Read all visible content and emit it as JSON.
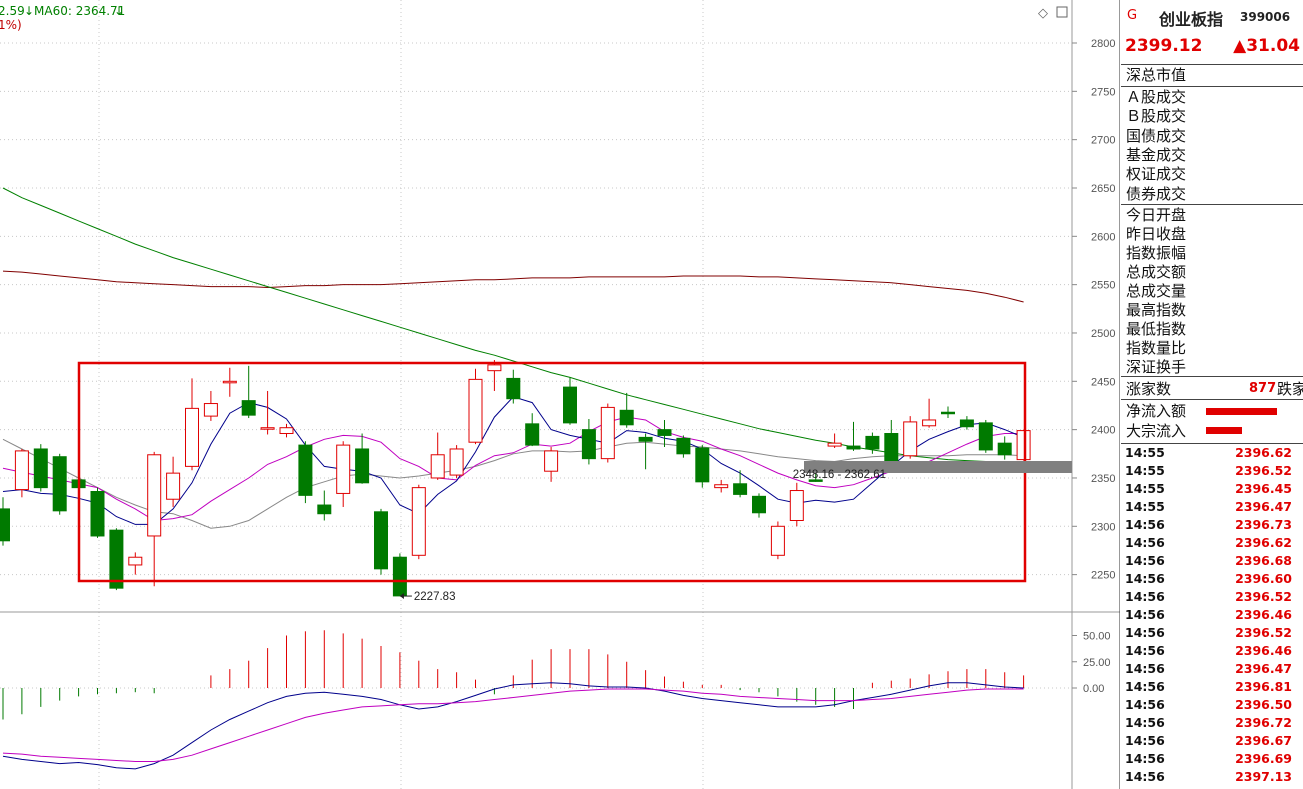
{
  "header": {
    "ma_fragment": "2.59",
    "ma60_label": "MA60: 2364.71",
    "pct_fragment": "1%)"
  },
  "y_axis": {
    "price_ticks": [
      "2800",
      "2750",
      "2700",
      "2650",
      "2600",
      "2550",
      "2500",
      "2450",
      "2400",
      "2350",
      "2300",
      "2250"
    ],
    "volume_ticks": [
      "50.00",
      "25.00",
      "0.00"
    ]
  },
  "annotations": {
    "low_label": "2227.83",
    "range_label": "2348.16 - 2362.61"
  },
  "colors": {
    "up": "#e00000",
    "down": "#007a00",
    "ma5": "#00008b",
    "ma10": "#c000c0",
    "ma20": "#888888",
    "ma60": "#008000",
    "ma250": "#800000",
    "box": "#e00000"
  },
  "chart_data": {
    "type": "candlestick",
    "y_range": [
      2210,
      2820
    ],
    "candles": [
      [
        2318,
        2285,
        2330,
        2280
      ],
      [
        2338,
        2378,
        2380,
        2330
      ],
      [
        2380,
        2340,
        2385,
        2336
      ],
      [
        2372,
        2316,
        2375,
        2312
      ],
      [
        2348,
        2340,
        2360,
        2336
      ],
      [
        2336,
        2290,
        2340,
        2288
      ],
      [
        2296,
        2236,
        2298,
        2234
      ],
      [
        2260,
        2268,
        2273,
        2250
      ],
      [
        2290,
        2374,
        2377,
        2238
      ],
      [
        2328,
        2355,
        2372,
        2320
      ],
      [
        2362,
        2422,
        2453,
        2358
      ],
      [
        2414,
        2427,
        2440,
        2409
      ],
      [
        2450,
        2450,
        2464,
        2434
      ],
      [
        2430,
        2415,
        2466,
        2412
      ],
      [
        2402,
        2402,
        2440,
        2395
      ],
      [
        2396,
        2402,
        2406,
        2392
      ],
      [
        2384,
        2332,
        2388,
        2324
      ],
      [
        2322,
        2313,
        2337,
        2306
      ],
      [
        2334,
        2384,
        2388,
        2320
      ],
      [
        2380,
        2345,
        2396,
        2344
      ],
      [
        2315,
        2256,
        2318,
        2250
      ],
      [
        2268,
        2228,
        2272,
        2227.83
      ],
      [
        2270,
        2340,
        2343,
        2266
      ],
      [
        2350,
        2374,
        2397,
        2348
      ],
      [
        2353,
        2380,
        2384,
        2350
      ],
      [
        2387,
        2452,
        2463,
        2385
      ],
      [
        2461,
        2467,
        2472,
        2440
      ],
      [
        2453,
        2432,
        2462,
        2427
      ],
      [
        2406,
        2384,
        2417,
        2383
      ],
      [
        2357,
        2378,
        2382,
        2346
      ],
      [
        2444,
        2407,
        2454,
        2405
      ],
      [
        2400,
        2370,
        2411,
        2364
      ],
      [
        2370,
        2423,
        2427,
        2366
      ],
      [
        2420,
        2405,
        2438,
        2402
      ],
      [
        2392,
        2388,
        2396,
        2359
      ],
      [
        2400,
        2394,
        2410,
        2382
      ],
      [
        2391,
        2375,
        2394,
        2371
      ],
      [
        2381,
        2346,
        2384,
        2340
      ],
      [
        2340,
        2343,
        2348,
        2335
      ],
      [
        2344,
        2333,
        2358,
        2330
      ],
      [
        2331,
        2314,
        2334,
        2309
      ],
      [
        2270,
        2300,
        2305,
        2266
      ],
      [
        2306,
        2337,
        2345,
        2300
      ],
      [
        2348,
        2347,
        2362.61,
        2346
      ],
      [
        2383,
        2386,
        2396,
        2381
      ],
      [
        2383,
        2380,
        2408,
        2378
      ],
      [
        2393,
        2380,
        2397,
        2375
      ],
      [
        2396,
        2366,
        2410,
        2366
      ],
      [
        2373,
        2408,
        2414,
        2370
      ],
      [
        2404,
        2410,
        2432,
        2402
      ],
      [
        2418,
        2417,
        2424,
        2412
      ],
      [
        2410,
        2403,
        2414,
        2400
      ],
      [
        2407,
        2379,
        2410,
        2376
      ],
      [
        2386,
        2374,
        2393,
        2369
      ],
      [
        2369,
        2399,
        2400,
        2368
      ]
    ],
    "moving_averages": {
      "ma5": [
        2336,
        2338,
        2334,
        2333,
        2329,
        2324,
        2310,
        2302,
        2302,
        2318,
        2345,
        2385,
        2417,
        2428,
        2423,
        2411,
        2384,
        2362,
        2359,
        2357,
        2350,
        2322,
        2313,
        2333,
        2347,
        2377,
        2413,
        2434,
        2428,
        2400,
        2394,
        2390,
        2386,
        2399,
        2397,
        2391,
        2388,
        2380,
        2365,
        2355,
        2342,
        2328,
        2324,
        2327,
        2325,
        2328,
        2345,
        2362,
        2378,
        2390,
        2398,
        2405,
        2407,
        2400,
        2392
      ],
      "ma10": [
        2360,
        2356,
        2352,
        2348,
        2344,
        2340,
        2328,
        2318,
        2306,
        2308,
        2312,
        2326,
        2338,
        2350,
        2364,
        2372,
        2382,
        2390,
        2394,
        2393,
        2387,
        2370,
        2362,
        2350,
        2348,
        2363,
        2373,
        2376,
        2385,
        2383,
        2386,
        2398,
        2408,
        2413,
        2410,
        2398,
        2392,
        2388,
        2380,
        2373,
        2364,
        2355,
        2348,
        2342,
        2340,
        2343,
        2350,
        2357,
        2362,
        2367,
        2376,
        2385,
        2393,
        2396,
        2396
      ],
      "ma20": [
        2390,
        2380,
        2370,
        2360,
        2350,
        2340,
        2330,
        2322,
        2315,
        2313,
        2306,
        2298,
        2300,
        2306,
        2318,
        2330,
        2340,
        2346,
        2352,
        2354,
        2352,
        2350,
        2352,
        2355,
        2358,
        2362,
        2368,
        2375,
        2378,
        2378,
        2377,
        2378,
        2382,
        2386,
        2387,
        2385,
        2383,
        2382,
        2380,
        2378,
        2375,
        2372,
        2370,
        2368,
        2367,
        2370,
        2372,
        2373,
        2373,
        2373,
        2373,
        2374,
        2374,
        2374,
        2373
      ],
      "ma60": [
        2650,
        2640,
        2632,
        2624,
        2616,
        2608,
        2600,
        2592,
        2585,
        2578,
        2572,
        2566,
        2560,
        2554,
        2548,
        2542,
        2536,
        2530,
        2524,
        2518,
        2512,
        2506,
        2500,
        2494,
        2488,
        2482,
        2477,
        2471,
        2465,
        2459,
        2454,
        2448,
        2442,
        2436,
        2431,
        2426,
        2421,
        2416,
        2411,
        2406,
        2401,
        2397,
        2393,
        2389,
        2386,
        2382,
        2379,
        2376,
        2373,
        2371,
        2369,
        2368,
        2367,
        2366,
        2365
      ],
      "ma250": [
        2564,
        2563,
        2561,
        2559,
        2557,
        2555,
        2553,
        2552,
        2551,
        2550,
        2549,
        2548,
        2548,
        2548,
        2547,
        2548,
        2549,
        2549,
        2550,
        2550,
        2550,
        2551,
        2552,
        2553,
        2554,
        2555,
        2555,
        2556,
        2557,
        2557,
        2557,
        2558,
        2558,
        2558,
        2558,
        2558,
        2559,
        2559,
        2559,
        2559,
        2558,
        2558,
        2557,
        2556,
        2555,
        2554,
        2553,
        2552,
        2550,
        2548,
        2546,
        2544,
        2541,
        2537,
        2532
      ]
    },
    "volume_indicator": {
      "y_range": [
        -35,
        62
      ],
      "bars": [
        -30,
        -25,
        -18,
        -12,
        -8,
        -6,
        -5,
        -4,
        -5,
        0,
        0,
        12,
        18,
        26,
        38,
        50,
        54,
        55,
        52,
        47,
        40,
        34,
        26,
        18,
        15,
        8,
        -6,
        12,
        27,
        37,
        37,
        37,
        32,
        25,
        17,
        11,
        6,
        3,
        3,
        -2,
        -4,
        -8,
        -13,
        -16,
        -18,
        -20,
        5,
        7,
        9,
        13,
        16,
        18,
        18,
        15,
        12
      ],
      "dif": [
        -65,
        -68,
        -70,
        -72,
        -71,
        -73,
        -76,
        -77,
        -72,
        -64,
        -52,
        -40,
        -30,
        -22,
        -14,
        -8,
        -5,
        -4,
        -6,
        -8,
        -11,
        -16,
        -20,
        -18,
        -13,
        -7,
        -1,
        3,
        4,
        5,
        4,
        2,
        1,
        1,
        0,
        -3,
        -7,
        -10,
        -12,
        -14,
        -16,
        -18,
        -18,
        -18,
        -16,
        -12,
        -9,
        -6,
        -2,
        2,
        5,
        5,
        3,
        1,
        0
      ],
      "dea": [
        -62,
        -63,
        -65,
        -66,
        -67,
        -68,
        -69,
        -70,
        -70,
        -68,
        -64,
        -58,
        -52,
        -46,
        -40,
        -34,
        -28,
        -24,
        -21,
        -18,
        -17,
        -16,
        -15,
        -15,
        -14,
        -13,
        -11,
        -9,
        -7,
        -5,
        -3,
        -2,
        -1,
        -1,
        -1,
        -2,
        -3,
        -5,
        -6,
        -8,
        -9,
        -10,
        -11,
        -12,
        -12,
        -12,
        -11,
        -10,
        -8,
        -6,
        -4,
        -2,
        -1,
        -1,
        -1
      ]
    }
  },
  "panel": {
    "g_label": "G",
    "name": "创业板指",
    "code": "399006",
    "price": "2399.12",
    "change": "▲31.04",
    "labels_a": [
      "深总市值"
    ],
    "labels_b": [
      "Ａ股成交",
      "Ｂ股成交",
      "国债成交",
      "基金成交",
      "权证成交",
      "债券成交"
    ],
    "labels_c": [
      "今日开盘",
      "昨日收盘",
      "指数振幅",
      "总成交额",
      "总成交量",
      "最高指数",
      "最低指数",
      "指数量比",
      "深证换手"
    ],
    "up_label": "涨家数",
    "up_value": "877",
    "down_label": "跌家",
    "net_inflow_label": "净流入额",
    "block_inflow_label": "大宗流入",
    "net_inflow_bar": 0.5,
    "block_inflow_bar": 0.25,
    "ticks": [
      {
        "t": "14:55",
        "v": "2396.62"
      },
      {
        "t": "14:55",
        "v": "2396.52"
      },
      {
        "t": "14:55",
        "v": "2396.45"
      },
      {
        "t": "14:55",
        "v": "2396.47"
      },
      {
        "t": "14:56",
        "v": "2396.73"
      },
      {
        "t": "14:56",
        "v": "2396.62"
      },
      {
        "t": "14:56",
        "v": "2396.68"
      },
      {
        "t": "14:56",
        "v": "2396.60"
      },
      {
        "t": "14:56",
        "v": "2396.52"
      },
      {
        "t": "14:56",
        "v": "2396.46"
      },
      {
        "t": "14:56",
        "v": "2396.52"
      },
      {
        "t": "14:56",
        "v": "2396.46"
      },
      {
        "t": "14:56",
        "v": "2396.47"
      },
      {
        "t": "14:56",
        "v": "2396.81"
      },
      {
        "t": "14:56",
        "v": "2396.50"
      },
      {
        "t": "14:56",
        "v": "2396.72"
      },
      {
        "t": "14:56",
        "v": "2396.67"
      },
      {
        "t": "14:56",
        "v": "2396.69"
      },
      {
        "t": "14:56",
        "v": "2397.13"
      }
    ]
  }
}
